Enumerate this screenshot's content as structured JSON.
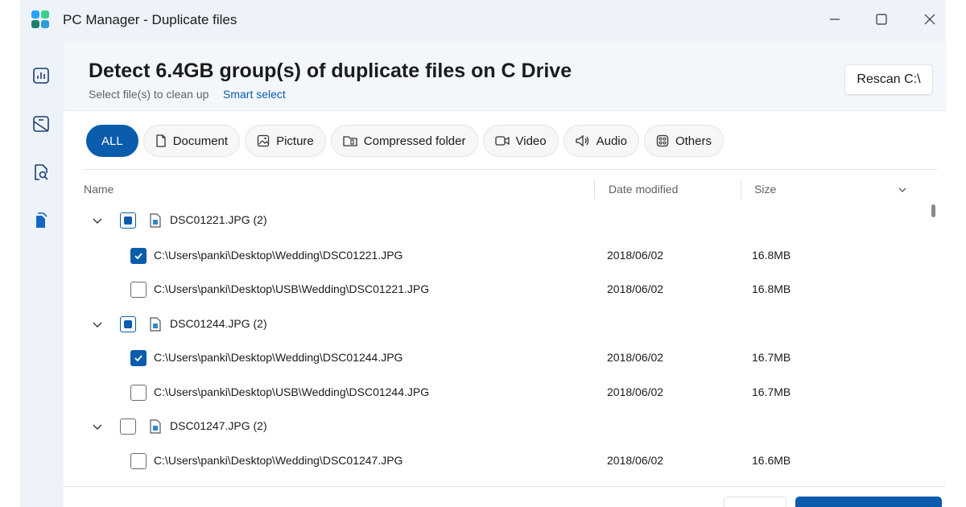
{
  "window": {
    "title": "PC Manager - Duplicate files"
  },
  "sidebar": {
    "items": [
      {
        "icon": "chart-icon"
      },
      {
        "icon": "storage-icon"
      },
      {
        "icon": "file-search-icon"
      },
      {
        "icon": "duplicate-files-icon"
      }
    ]
  },
  "header": {
    "title": "Detect 6.4GB group(s) of duplicate files on C Drive",
    "subtitle": "Select file(s) to clean up",
    "smart_select": "Smart select",
    "rescan_label": "Rescan C:\\"
  },
  "filters": {
    "all": "ALL",
    "document": "Document",
    "picture": "Picture",
    "compressed": "Compressed folder",
    "video": "Video",
    "audio": "Audio",
    "others": "Others"
  },
  "table": {
    "columns": {
      "name": "Name",
      "date": "Date modified",
      "size": "Size"
    },
    "groups": [
      {
        "name": "DSC01221.JPG (2)",
        "state": "partial",
        "files": [
          {
            "path": "C:\\Users\\panki\\Desktop\\Wedding\\DSC01221.JPG",
            "date": "2018/06/02",
            "size": "16.8MB",
            "checked": true
          },
          {
            "path": "C:\\Users\\panki\\Desktop\\USB\\Wedding\\DSC01221.JPG",
            "date": "2018/06/02",
            "size": "16.8MB",
            "checked": false
          }
        ]
      },
      {
        "name": "DSC01244.JPG (2)",
        "state": "partial",
        "files": [
          {
            "path": "C:\\Users\\panki\\Desktop\\Wedding\\DSC01244.JPG",
            "date": "2018/06/02",
            "size": "16.7MB",
            "checked": true
          },
          {
            "path": "C:\\Users\\panki\\Desktop\\USB\\Wedding\\DSC01244.JPG",
            "date": "2018/06/02",
            "size": "16.7MB",
            "checked": false
          }
        ]
      },
      {
        "name": "DSC01247.JPG (2)",
        "state": "unchecked",
        "files": [
          {
            "path": "C:\\Users\\panki\\Desktop\\Wedding\\DSC01247.JPG",
            "date": "2018/06/02",
            "size": "16.6MB",
            "checked": false
          }
        ]
      }
    ]
  },
  "colors": {
    "accent": "#0b5cad",
    "window_bg": "#eef3fa"
  }
}
